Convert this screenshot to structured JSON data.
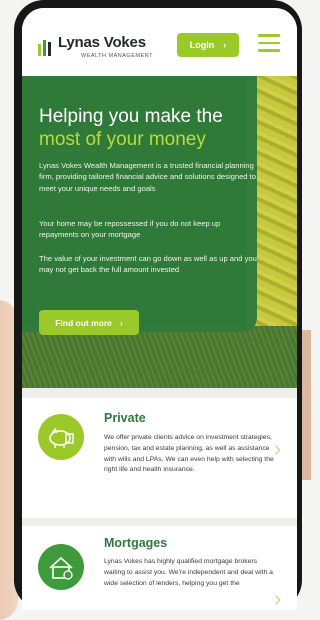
{
  "header": {
    "brand_name": "Lynas Vokes",
    "brand_sub": "WEALTH MANAGEMENT",
    "login_label": "Login",
    "login_arrow": "›"
  },
  "hero": {
    "title_line1": "Helping you make the",
    "title_line2": "most of your money",
    "paragraph1": "Lynas Vokes Wealth Management is a trusted financial planning firm, providing tailored financial advice and solutions designed to meet your unique needs and goals",
    "paragraph2": "Your home may be repossessed if you do not keep up repayments on your mortgage",
    "paragraph3": "The value of your investment can go down as well as up and you may not get back the full amount invested",
    "cta_label": "Find out more",
    "cta_arrow": "›"
  },
  "services": [
    {
      "title": "Private",
      "text": "We offer private clients advice on investment strategies, pension, tax and estate planning, as well as assistance with wills and LPAs. We can even help with selecting the right life and health insurance.",
      "chevron": "›"
    },
    {
      "title": "Mortgages",
      "text": "Lynas Vokes has highly qualified mortgage brokers waiting to assist you. We're independent and deal with a wide selection of lenders, helping you get the",
      "chevron": "›"
    }
  ],
  "colors": {
    "accent_green": "#9bc92a",
    "brand_green": "#2f7a3a",
    "title_highlight": "#b9dc3c"
  }
}
